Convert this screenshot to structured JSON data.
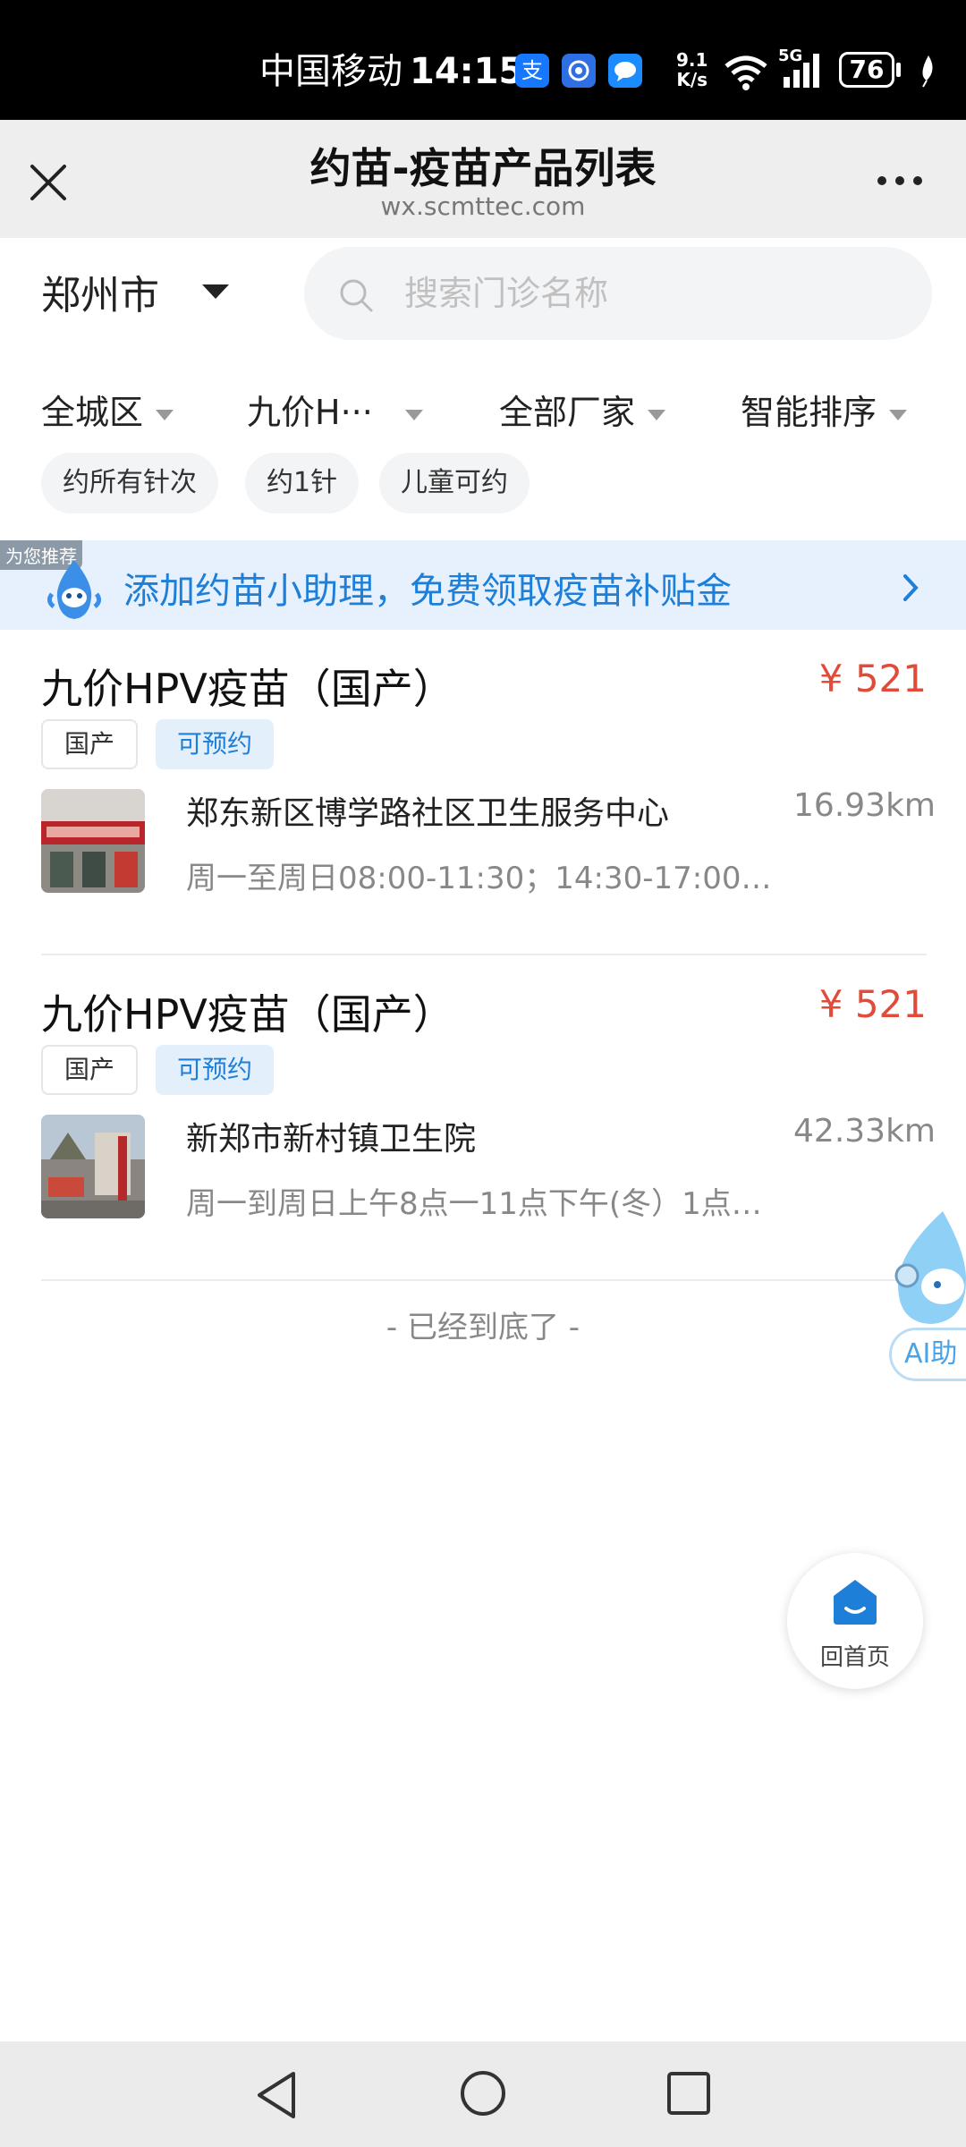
{
  "status_bar": {
    "carrier": "中国移动",
    "time": "14:15",
    "net_speed_top": "9.1",
    "net_speed_bottom": "K/s",
    "signal_label": "5G",
    "battery": "76",
    "app_icons": [
      "alipay-icon",
      "shield-app-icon",
      "message-icon"
    ]
  },
  "header": {
    "title": "约苗-疫苗产品列表",
    "url": "wx.scmttec.com"
  },
  "search": {
    "city": "郑州市",
    "placeholder": "搜索门诊名称"
  },
  "filters": [
    {
      "label": "全城区"
    },
    {
      "label": "九价H···"
    },
    {
      "label": "全部厂家"
    },
    {
      "label": "智能排序"
    }
  ],
  "chips": [
    {
      "label": "约所有针次"
    },
    {
      "label": "约1针"
    },
    {
      "label": "儿童可约"
    }
  ],
  "banner": {
    "tag": "为您推荐",
    "text": "添加约苗小助理，免费领取疫苗补贴金"
  },
  "products": [
    {
      "name": "九价HPV疫苗（国产）",
      "price": "¥ 521",
      "tag_domestic": "国产",
      "tag_bookable": "可预约",
      "clinic": "郑东新区博学路社区卫生服务中心",
      "distance": "16.93km",
      "hours": "周一至周日08:00-11:30；14:30-17:00（…"
    },
    {
      "name": "九价HPV疫苗（国产）",
      "price": "¥ 521",
      "tag_domestic": "国产",
      "tag_bookable": "可预约",
      "clinic": "新郑市新村镇卫生院",
      "distance": "42.33km",
      "hours": "周一到周日上午8点一11点下午(冬）1点…"
    }
  ],
  "end_text": "- 已经到底了 -",
  "ai_helper": {
    "label": "AI助"
  },
  "home_button": {
    "label": "回首页"
  },
  "colors": {
    "accent": "#1e7fd8",
    "price": "#e04b3a",
    "banner_bg": "#e6f1fd"
  }
}
